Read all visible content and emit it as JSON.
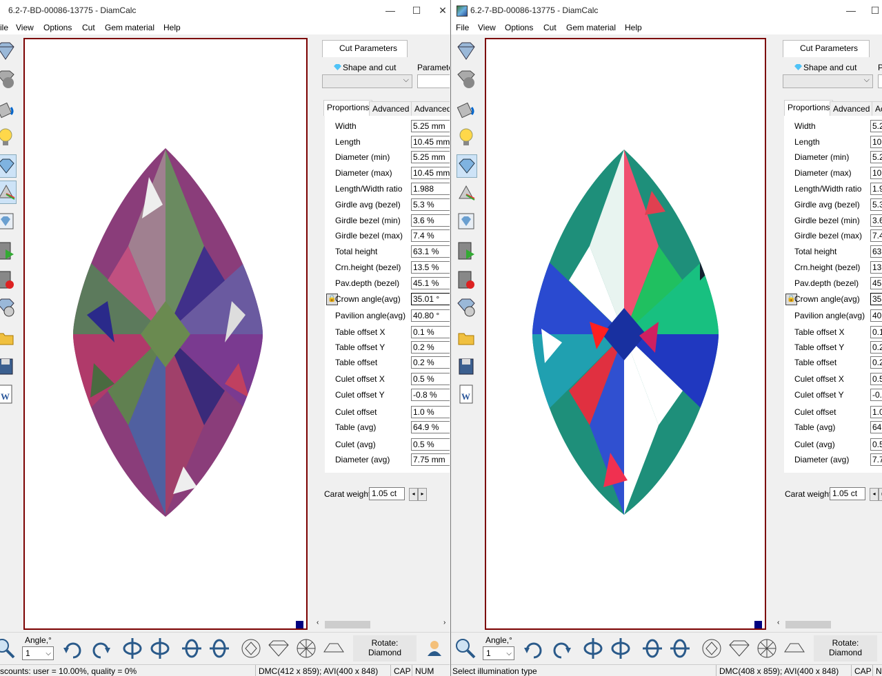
{
  "left_window": {
    "title": "6.2-7-BD-00086-13775 - DiamCalc",
    "menu": [
      "ile",
      "View",
      "Options",
      "Cut",
      "Gem material",
      "Help"
    ],
    "tab_header": "Cut Parameters",
    "shape_and_cut_label": "Shape and cut",
    "parameters_label": "Parameter",
    "shape_value": "",
    "subtabs": [
      "Proportions",
      "Advanced",
      "Advanced"
    ],
    "properties": [
      {
        "label": "Width",
        "value": "5.25 mm"
      },
      {
        "label": "Length",
        "value": "10.45 mm"
      },
      {
        "label": "Diameter (min)",
        "value": "5.25 mm"
      },
      {
        "label": "Diameter (max)",
        "value": "10.45 mm"
      },
      {
        "label": "Length/Width ratio",
        "value": "1.988"
      },
      {
        "label": "Girdle avg (bezel)",
        "value": "5.3 %"
      },
      {
        "label": "Girdle bezel (min)",
        "value": "3.6 %"
      },
      {
        "label": "Girdle bezel (max)",
        "value": "7.4 %"
      },
      {
        "label": "Total height",
        "value": "63.1 %"
      },
      {
        "label": "Crn.height (bezel)",
        "value": "13.5 %"
      },
      {
        "label": "Pav.depth (bezel)",
        "value": "45.1 %"
      },
      {
        "label": "Crown angle(avg)",
        "value": "35.01 °"
      },
      {
        "label": "Pavilion angle(avg)",
        "value": "40.80 °"
      },
      {
        "label": "Table offset X",
        "value": "0.1 %"
      },
      {
        "label": "Table offset Y",
        "value": "0.2 %"
      },
      {
        "label": "Table offset",
        "value": "0.2 %"
      },
      {
        "label": "Culet offset X",
        "value": "0.5 %"
      },
      {
        "label": "Culet offset Y",
        "value": "-0.8 %"
      },
      {
        "label": "Culet offset",
        "value": "1.0 %"
      },
      {
        "label": "Table (avg)",
        "value": "64.9 %"
      },
      {
        "label": "Culet (avg)",
        "value": "0.5 %"
      },
      {
        "label": "Diameter (avg)",
        "value": "7.75 mm"
      }
    ],
    "carat_label": "Carat weight",
    "carat_value": "1.05 ct",
    "angle_label": "Angle,°",
    "angle_value": "1",
    "rotate_label": "Rotate:",
    "rotate_value": "Diamond",
    "status": [
      "scounts: user = 10.00%, quality = 0%",
      "DMC(412 x 859); AVI(400 x 848)",
      "CAP",
      "NUM"
    ]
  },
  "right_window": {
    "title": "6.2-7-BD-00086-13775 - DiamCalc",
    "menu": [
      "File",
      "View",
      "Options",
      "Cut",
      "Gem material",
      "Help"
    ],
    "tab_header": "Cut Parameters",
    "shape_and_cut_label": "Shape and cut",
    "parameters_label": "P",
    "subtabs": [
      "Proportions",
      "Advanced",
      "Ac"
    ],
    "properties": [
      {
        "label": "Width",
        "value": "5.2"
      },
      {
        "label": "Length",
        "value": "10"
      },
      {
        "label": "Diameter (min)",
        "value": "5.2"
      },
      {
        "label": "Diameter (max)",
        "value": "10"
      },
      {
        "label": "Length/Width ratio",
        "value": "1.9"
      },
      {
        "label": "Girdle avg (bezel)",
        "value": "5.3"
      },
      {
        "label": "Girdle bezel (min)",
        "value": "3.6"
      },
      {
        "label": "Girdle bezel (max)",
        "value": "7.4"
      },
      {
        "label": "Total height",
        "value": "63"
      },
      {
        "label": "Crn.height (bezel)",
        "value": "13"
      },
      {
        "label": "Pav.depth (bezel)",
        "value": "45"
      },
      {
        "label": "Crown angle(avg)",
        "value": "35"
      },
      {
        "label": "Pavilion angle(avg)",
        "value": "40"
      },
      {
        "label": "Table offset X",
        "value": "0.1"
      },
      {
        "label": "Table offset Y",
        "value": "0.2"
      },
      {
        "label": "Table offset",
        "value": "0.2"
      },
      {
        "label": "Culet offset X",
        "value": "0.5"
      },
      {
        "label": "Culet offset Y",
        "value": "-0."
      },
      {
        "label": "Culet offset",
        "value": "1.0"
      },
      {
        "label": "Table (avg)",
        "value": "64"
      },
      {
        "label": "Culet (avg)",
        "value": "0.5"
      },
      {
        "label": "Diameter (avg)",
        "value": "7.7"
      }
    ],
    "carat_label": "Carat weight",
    "carat_value": "1.05 ct",
    "angle_label": "Angle,°",
    "angle_value": "1",
    "rotate_label": "Rotate:",
    "rotate_value": "Diamond",
    "status": [
      "Select illumination type",
      "DMC(408 x 859); AVI(400 x 848)",
      "CAP",
      "N"
    ]
  },
  "colors": {
    "viewport_border": "#7b0000",
    "corner_marker": "#000080",
    "gem_left": "#8a3d7a",
    "gem_right": "#1e8f7a"
  },
  "icons": {
    "toolbar": [
      "diamond-view-icon",
      "sphere-icon",
      "paint-bucket-icon",
      "lightbulb-icon",
      "diamond-selected-icon",
      "rainbow-prism-icon",
      "diamond-image-icon",
      "film-play-icon",
      "film-record-icon",
      "diamond-wheel-icon",
      "open-folder-icon",
      "save-disk-icon",
      "word-export-icon"
    ],
    "bottom": [
      "magnify-icon",
      "rotate-cw-icon",
      "rotate-ccw-icon",
      "flip-v1-icon",
      "flip-v2-icon",
      "flip-h1-icon",
      "flip-h2-icon",
      "top-view-icon",
      "side-view-icon",
      "bottom-view-icon",
      "profile-view-icon"
    ]
  }
}
